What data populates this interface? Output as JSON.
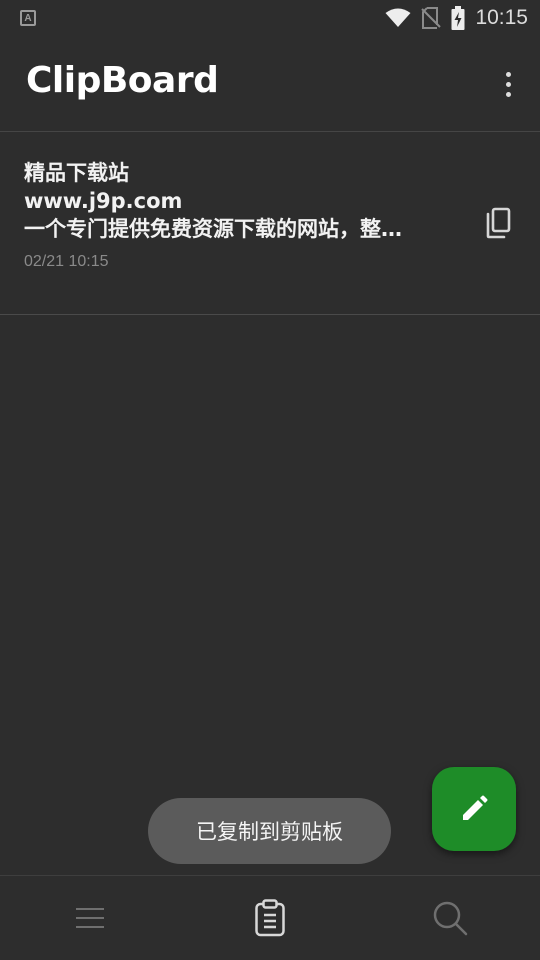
{
  "status_bar": {
    "time": "10:15",
    "left_badge": "A",
    "icons": [
      "wifi-icon",
      "no-sim-icon",
      "battery-charging-icon"
    ]
  },
  "app": {
    "title": "ClipBoard",
    "menu_icon": "more-vert-icon"
  },
  "clips": [
    {
      "lines": [
        "精品下载站",
        "www.j9p.com",
        "一个专门提供免费资源下载的网站，整…"
      ],
      "date": "02/21 10:15",
      "action_icon": "copy-icon"
    }
  ],
  "fab": {
    "icon": "edit-pencil-icon",
    "color": "#1e8c28"
  },
  "toast": {
    "text": "已复制到剪贴板"
  },
  "bottom_nav": {
    "items": [
      {
        "icon": "menu-lines-icon",
        "active": false
      },
      {
        "icon": "clipboard-icon",
        "active": true
      },
      {
        "icon": "search-icon",
        "active": false
      }
    ]
  },
  "colors": {
    "background": "#2d2d2d",
    "accent": "#1e8c28",
    "toast_bg": "#5b5b5b"
  }
}
